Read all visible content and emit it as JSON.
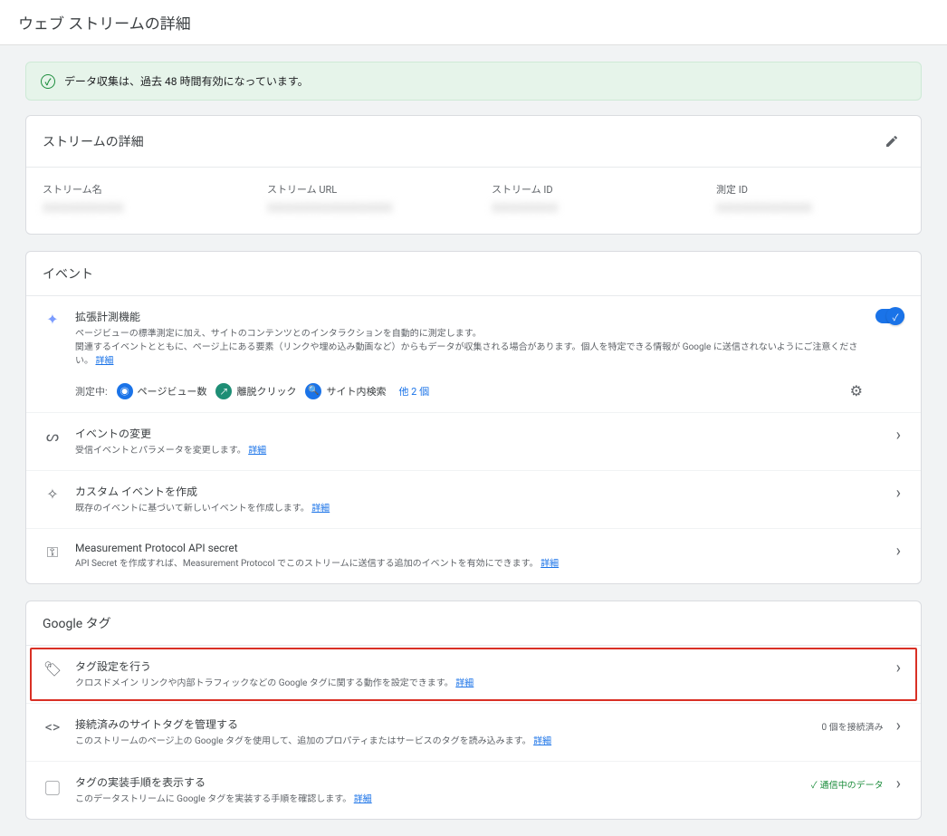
{
  "page_title": "ウェブ ストリームの詳細",
  "alert_text": "データ収集は、過去 48 時間有効になっています。",
  "stream_details": {
    "header": "ストリームの詳細",
    "cols": [
      {
        "label": "ストリーム名",
        "value": "XXXXXXXXXXX"
      },
      {
        "label": "ストリーム URL",
        "value": "XXXXXXXXXXXXXXXXX"
      },
      {
        "label": "ストリーム ID",
        "value": "XXXXXXXXX"
      },
      {
        "label": "測定 ID",
        "value": "XXXXXXXXXXXXX"
      }
    ]
  },
  "events": {
    "header": "イベント",
    "enhanced": {
      "title": "拡張計測機能",
      "desc1": "ページビューの標準測定に加え、サイトのコンテンツとのインタラクションを自動的に測定します。",
      "desc2": "関連するイベントとともに、ページ上にある要素（リンクや埋め込み動画など）からもデータが収集される場合があります。個人を特定できる情報が Google に送信されないようにご注意ください。",
      "link": "詳細",
      "measuring_label": "測定中:",
      "chip1": "ページビュー数",
      "chip2": "離脱クリック",
      "chip3": "サイト内検索",
      "more": "他 2 個"
    },
    "rows": [
      {
        "title": "イベントの変更",
        "desc": "受信イベントとパラメータを変更します。",
        "link": "詳細"
      },
      {
        "title": "カスタム イベントを作成",
        "desc": "既存のイベントに基づいて新しいイベントを作成します。",
        "link": "詳細"
      },
      {
        "title": "Measurement Protocol API secret",
        "desc": "API Secret を作成すれば、Measurement Protocol でこのストリームに送信する追加のイベントを有効にできます。",
        "link": "詳細"
      }
    ]
  },
  "gtag": {
    "header": "Google タグ",
    "rows": [
      {
        "title": "タグ設定を行う",
        "desc": "クロスドメイン リンクや内部トラフィックなどの Google タグに関する動作を設定できます。",
        "link": "詳細"
      },
      {
        "title": "接続済みのサイトタグを管理する",
        "desc": "このストリームのページ上の Google タグを使用して、追加のプロパティまたはサービスのタグを読み込みます。",
        "link": "詳細",
        "badge": "0 個を接続済み"
      },
      {
        "title": "タグの実装手順を表示する",
        "desc": "このデータストリームに Google タグを実装する手順を確認します。",
        "link": "詳細",
        "badge_green": "通信中のデータ"
      }
    ]
  }
}
